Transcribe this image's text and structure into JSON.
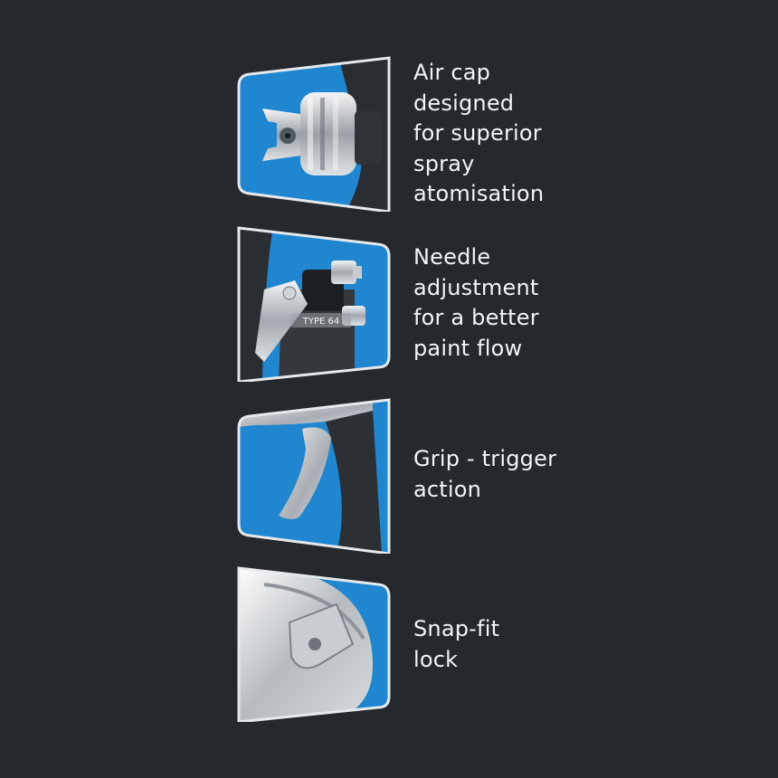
{
  "features": [
    {
      "icon": "air-cap-icon",
      "lines": [
        "Air cap",
        "designed",
        "for superior",
        "spray",
        "atomisation"
      ]
    },
    {
      "icon": "needle-adjustment-icon",
      "lines": [
        "Needle",
        "adjustment",
        "for a better",
        "paint flow"
      ],
      "engraving": "TYPE 64"
    },
    {
      "icon": "grip-trigger-icon",
      "lines": [
        "Grip - trigger",
        "action"
      ]
    },
    {
      "icon": "snap-fit-lock-icon",
      "lines": [
        "Snap-fit",
        "lock"
      ]
    }
  ],
  "colors": {
    "background": "#25292d",
    "panel": "#1f86cf",
    "frame": "#e6e9ec",
    "text": "#f2f4f6"
  }
}
